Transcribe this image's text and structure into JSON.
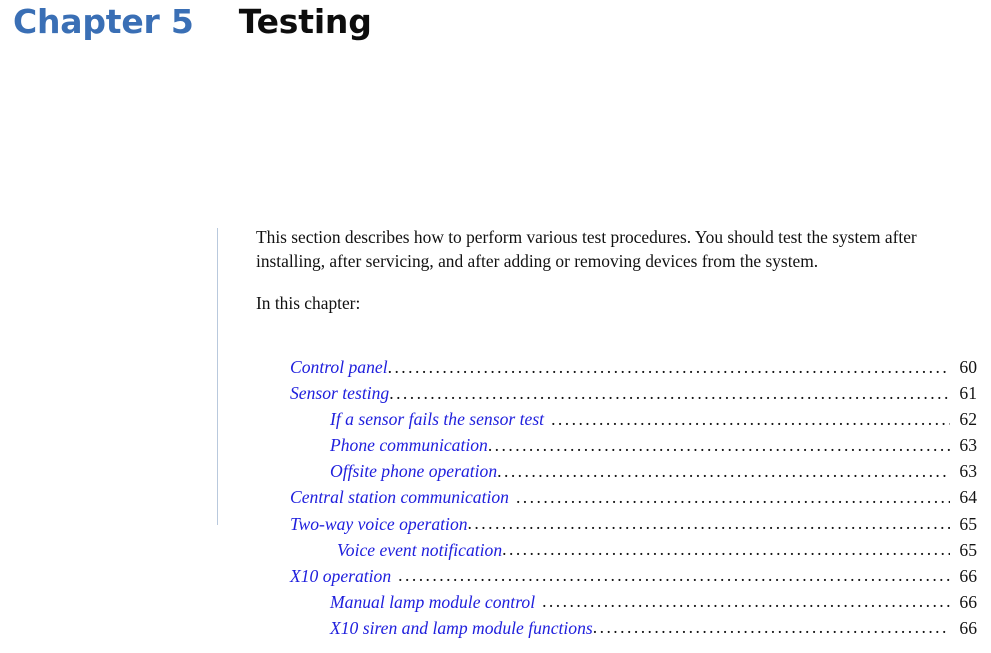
{
  "header": {
    "chapter_label": "Chapter 5",
    "chapter_title": "Testing",
    "chapter_label_color": "#3a6fb5",
    "chapter_title_color": "#0d0d0d"
  },
  "body": {
    "paragraph_1": "This section describes how to perform various test procedures.  You should test the system after installing, after servicing, and after adding or removing devices from the system.",
    "paragraph_2": "In this chapter:"
  },
  "toc": {
    "entry_color": "#2020dd",
    "page_color": "#141414",
    "entries": [
      {
        "title": "Control panel",
        "page": "60",
        "level": 1,
        "spaced_leader": false,
        "extra_indent": false
      },
      {
        "title": "Sensor testing",
        "page": "61",
        "level": 1,
        "spaced_leader": false,
        "extra_indent": false
      },
      {
        "title": "If a sensor fails the sensor test",
        "page": "62",
        "level": 2,
        "spaced_leader": true,
        "extra_indent": false
      },
      {
        "title": "Phone communication",
        "page": "63",
        "level": 2,
        "spaced_leader": false,
        "extra_indent": false
      },
      {
        "title": "Offsite phone operation",
        "page": "63",
        "level": 2,
        "spaced_leader": false,
        "extra_indent": false
      },
      {
        "title": "Central station communication",
        "page": "64",
        "level": 1,
        "spaced_leader": true,
        "extra_indent": false
      },
      {
        "title": "Two-way voice operation",
        "page": "65",
        "level": 1,
        "spaced_leader": false,
        "extra_indent": false
      },
      {
        "title": "Voice event notification",
        "page": "65",
        "level": 2,
        "spaced_leader": false,
        "extra_indent": true
      },
      {
        "title": "X10 operation",
        "page": "66",
        "level": 1,
        "spaced_leader": true,
        "extra_indent": false
      },
      {
        "title": "Manual lamp module control",
        "page": "66",
        "level": 2,
        "spaced_leader": true,
        "extra_indent": false
      },
      {
        "title": "X10 siren and lamp module functions",
        "page": "66",
        "level": 2,
        "spaced_leader": false,
        "extra_indent": false
      }
    ]
  },
  "decor": {
    "side_rule_color": "#b9c9dd"
  }
}
